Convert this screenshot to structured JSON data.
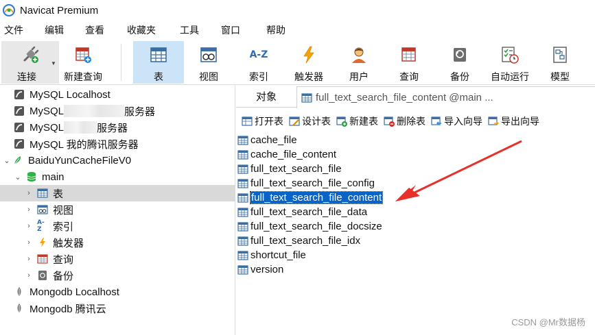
{
  "window": {
    "title": "Navicat Premium"
  },
  "menu": [
    "文件",
    "编辑",
    "查看",
    "收藏夹",
    "工具",
    "窗口",
    "帮助"
  ],
  "toolbar": {
    "connect": "连接",
    "new_query": "新建查询",
    "table": "表",
    "view": "视图",
    "index": "索引",
    "index_glyph": "A-Z",
    "trigger": "触发器",
    "user": "用户",
    "query": "查询",
    "backup": "备份",
    "automation": "自动运行",
    "model": "模型"
  },
  "tree": {
    "connections": [
      {
        "label": "MySQL Localhost"
      },
      {
        "prefix": "MySQL",
        "suffix": "服务器"
      },
      {
        "prefix": "MySQL",
        "suffix": "服务器"
      },
      {
        "label": "MySQL 我的腾讯服务器"
      },
      {
        "label": "BaiduYunCacheFileV0"
      }
    ],
    "schema": "main",
    "children": [
      "表",
      "视图",
      "索引",
      "触发器",
      "查询",
      "备份"
    ],
    "mongo": [
      "Mongodb Localhost",
      "Mongodb 腾讯云"
    ]
  },
  "tabs": {
    "objects": "对象",
    "active": "full_text_search_file_content @main ..."
  },
  "object_toolbar": {
    "open": "打开表",
    "design": "设计表",
    "new": "新建表",
    "delete": "删除表",
    "import": "导入向导",
    "export": "导出向导"
  },
  "tables": [
    "cache_file",
    "cache_file_content",
    "full_text_search_file",
    "full_text_search_file_config",
    "full_text_search_file_content",
    "full_text_search_file_data",
    "full_text_search_file_docsize",
    "full_text_search_file_idx",
    "shortcut_file",
    "version"
  ],
  "selected_table": "full_text_search_file_content",
  "watermark": "CSDN @Mr数据杨",
  "colors": {
    "accent": "#0a64c8",
    "arrow": "#e8302a",
    "toolbar_active": "#cce4f7"
  }
}
